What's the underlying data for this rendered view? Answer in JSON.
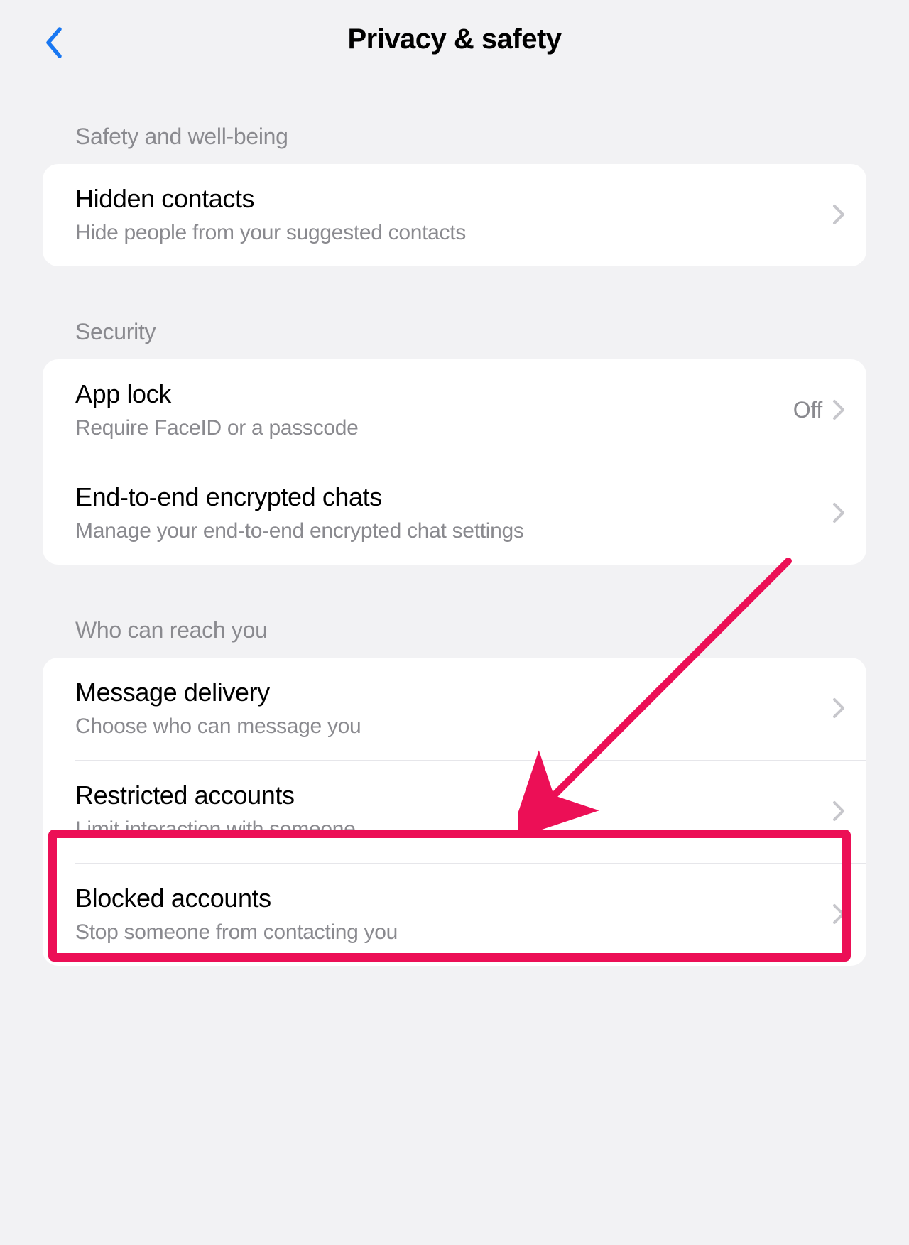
{
  "header": {
    "title": "Privacy & safety"
  },
  "sections": {
    "safety": {
      "label": "Safety and well-being",
      "hidden_contacts": {
        "title": "Hidden contacts",
        "subtitle": "Hide people from your suggested contacts"
      }
    },
    "security": {
      "label": "Security",
      "app_lock": {
        "title": "App lock",
        "subtitle": "Require FaceID or a passcode",
        "value": "Off"
      },
      "e2ee": {
        "title": "End-to-end encrypted chats",
        "subtitle": "Manage your end-to-end encrypted chat settings"
      }
    },
    "reach": {
      "label": "Who can reach you",
      "message_delivery": {
        "title": "Message delivery",
        "subtitle": "Choose who can message you"
      },
      "restricted": {
        "title": "Restricted accounts",
        "subtitle": "Limit interaction with someone"
      },
      "blocked": {
        "title": "Blocked accounts",
        "subtitle": "Stop someone from contacting you"
      }
    }
  },
  "annotation": {
    "highlight_color": "#ec0f56",
    "arrow_color": "#ec0f56"
  }
}
